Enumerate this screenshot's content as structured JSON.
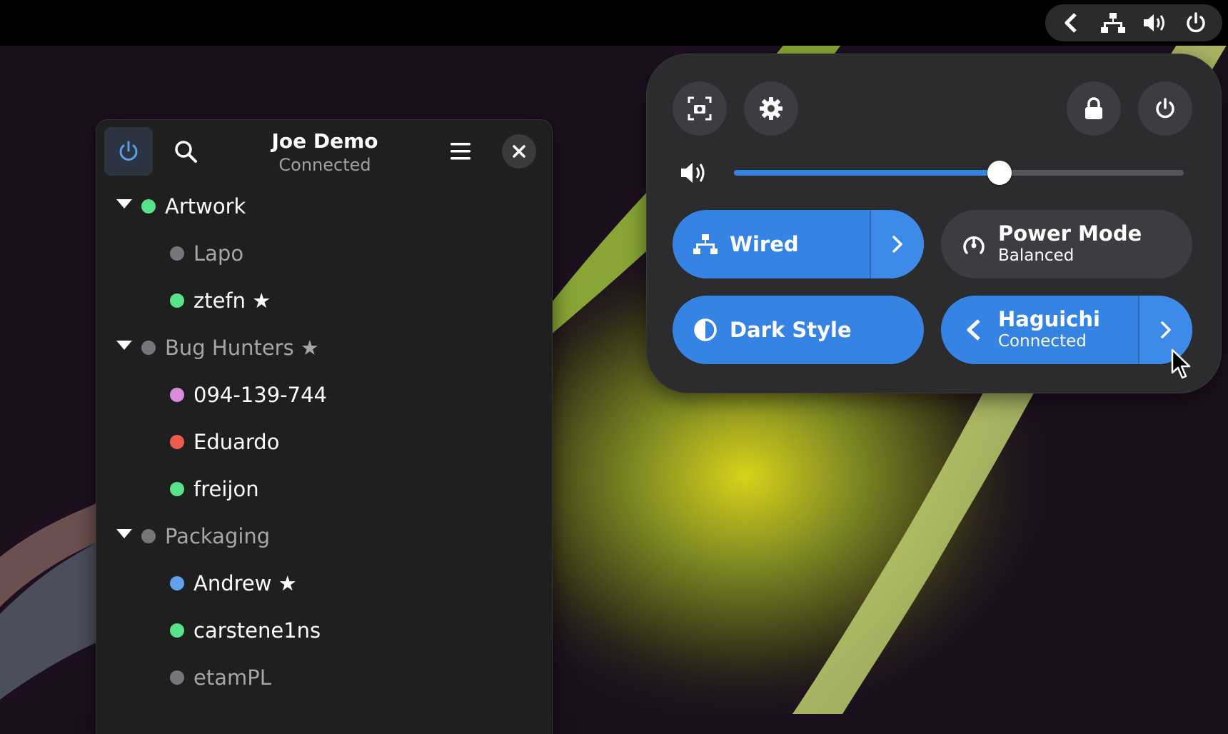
{
  "topbar": {
    "tray_icons": [
      "chevron-left-icon",
      "network-wired-icon",
      "volume-icon",
      "power-icon"
    ]
  },
  "contacts_window": {
    "title": "Joe Demo",
    "subtitle": "Connected",
    "groups": [
      {
        "label": "Artwork",
        "status_color": "#57e389",
        "dim": false,
        "members": [
          {
            "label": "Lapo",
            "status_color": "#77767b",
            "dim": true
          },
          {
            "label": "ztefn ★",
            "status_color": "#57e389",
            "dim": false
          }
        ]
      },
      {
        "label": "Bug Hunters ★",
        "status_color": "#77767b",
        "dim": true,
        "members": [
          {
            "label": "094-139-744",
            "status_color": "#dc8add",
            "dim": false
          },
          {
            "label": "Eduardo",
            "status_color": "#ed5b4e",
            "dim": false
          },
          {
            "label": "freijon",
            "status_color": "#57e389",
            "dim": false
          }
        ]
      },
      {
        "label": "Packaging",
        "status_color": "#77767b",
        "dim": true,
        "members": [
          {
            "label": "Andrew ★",
            "status_color": "#62a0ea",
            "dim": false
          },
          {
            "label": "carstene1ns",
            "status_color": "#57e389",
            "dim": false
          },
          {
            "label": "etamPL",
            "status_color": "#77767b",
            "dim": true
          }
        ]
      }
    ]
  },
  "quick_settings": {
    "volume_level": 0.59,
    "tiles": {
      "wired": {
        "title": "Wired",
        "active": true
      },
      "power_mode": {
        "title": "Power Mode",
        "subtitle": "Balanced",
        "active": false
      },
      "dark_style": {
        "title": "Dark Style",
        "active": true
      },
      "haguichi": {
        "title": "Haguichi",
        "subtitle": "Connected",
        "active": true
      }
    }
  },
  "colors": {
    "accent": "#3584e4",
    "online": "#57e389",
    "offline": "#77767b"
  }
}
